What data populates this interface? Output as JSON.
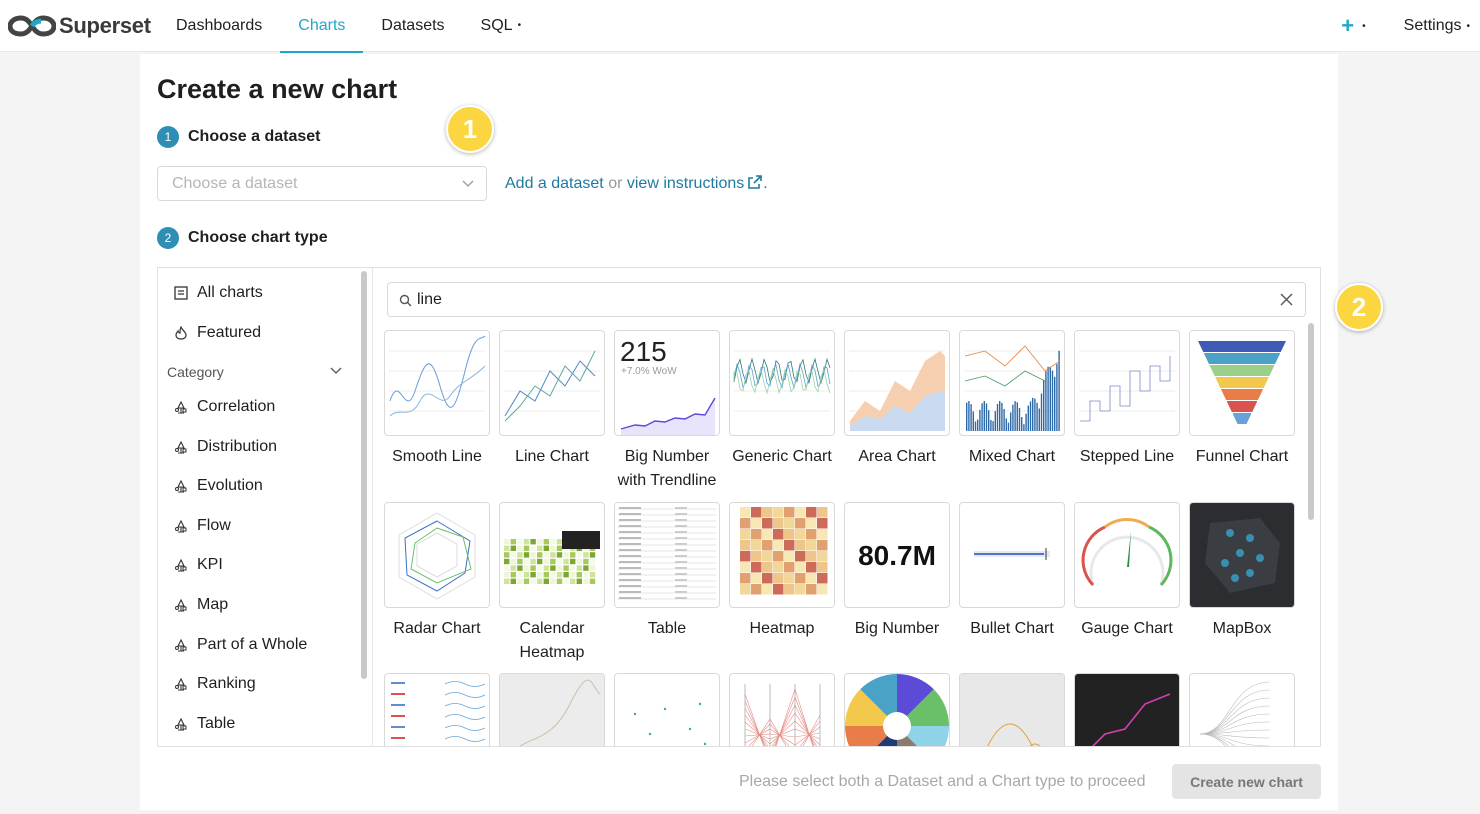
{
  "app": {
    "name": "Superset"
  },
  "nav": {
    "items": [
      {
        "label": "Dashboards",
        "active": false
      },
      {
        "label": "Charts",
        "active": true
      },
      {
        "label": "Datasets",
        "active": false
      },
      {
        "label": "SQL",
        "active": false
      }
    ],
    "add_icon": "plus-icon",
    "settings_label": "Settings"
  },
  "page": {
    "title": "Create a new chart",
    "step1": {
      "number": "1",
      "label": "Choose a dataset"
    },
    "step2": {
      "number": "2",
      "label": "Choose chart type"
    },
    "dataset_select": {
      "placeholder": "Choose a dataset"
    },
    "dataset_links": {
      "add": "Add a dataset",
      "or": " or ",
      "view": "view instructions",
      "period": "."
    },
    "callouts": [
      "1",
      "2"
    ]
  },
  "sidebar": {
    "top_items": [
      {
        "label": "All charts",
        "icon": "all-charts-icon"
      },
      {
        "label": "Featured",
        "icon": "fire-icon"
      }
    ],
    "category_label": "Category",
    "categories": [
      "Correlation",
      "Distribution",
      "Evolution",
      "Flow",
      "KPI",
      "Map",
      "Part of a Whole",
      "Ranking",
      "Table"
    ]
  },
  "search": {
    "value": "line"
  },
  "charts": [
    {
      "label": "Smooth Line",
      "thumb": "smooth-line"
    },
    {
      "label": "Line Chart",
      "thumb": "line"
    },
    {
      "label": "Big Number with Trendline",
      "thumb": "bignumber-trend",
      "number": "215",
      "sub": "+7.0% WoW"
    },
    {
      "label": "Generic Chart",
      "thumb": "generic"
    },
    {
      "label": "Area Chart",
      "thumb": "area"
    },
    {
      "label": "Mixed Chart",
      "thumb": "mixed"
    },
    {
      "label": "Stepped Line",
      "thumb": "stepped"
    },
    {
      "label": "Funnel Chart",
      "thumb": "funnel"
    },
    {
      "label": "Radar Chart",
      "thumb": "radar"
    },
    {
      "label": "Calendar Heatmap",
      "thumb": "calendar"
    },
    {
      "label": "Table",
      "thumb": "table"
    },
    {
      "label": "Heatmap",
      "thumb": "heatmap"
    },
    {
      "label": "Big Number",
      "thumb": "bignumber",
      "number": "80.7M"
    },
    {
      "label": "Bullet Chart",
      "thumb": "bullet"
    },
    {
      "label": "Gauge Chart",
      "thumb": "gauge"
    },
    {
      "label": "MapBox",
      "thumb": "mapbox"
    },
    {
      "label": "",
      "thumb": "timetable"
    },
    {
      "label": "",
      "thumb": "map-light"
    },
    {
      "label": "",
      "thumb": "scatter"
    },
    {
      "label": "",
      "thumb": "parallel"
    },
    {
      "label": "",
      "thumb": "sunburst"
    },
    {
      "label": "",
      "thumb": "arcs"
    },
    {
      "label": "",
      "thumb": "path-dark"
    },
    {
      "label": "",
      "thumb": "tree"
    }
  ],
  "footer": {
    "message": "Please select both a Dataset and a Chart type to proceed",
    "create_label": "Create new chart"
  },
  "colors": {
    "accent": "#20a7c9",
    "step": "#2f8eb3",
    "link": "#1f7aa0",
    "callout": "#fbd640"
  }
}
